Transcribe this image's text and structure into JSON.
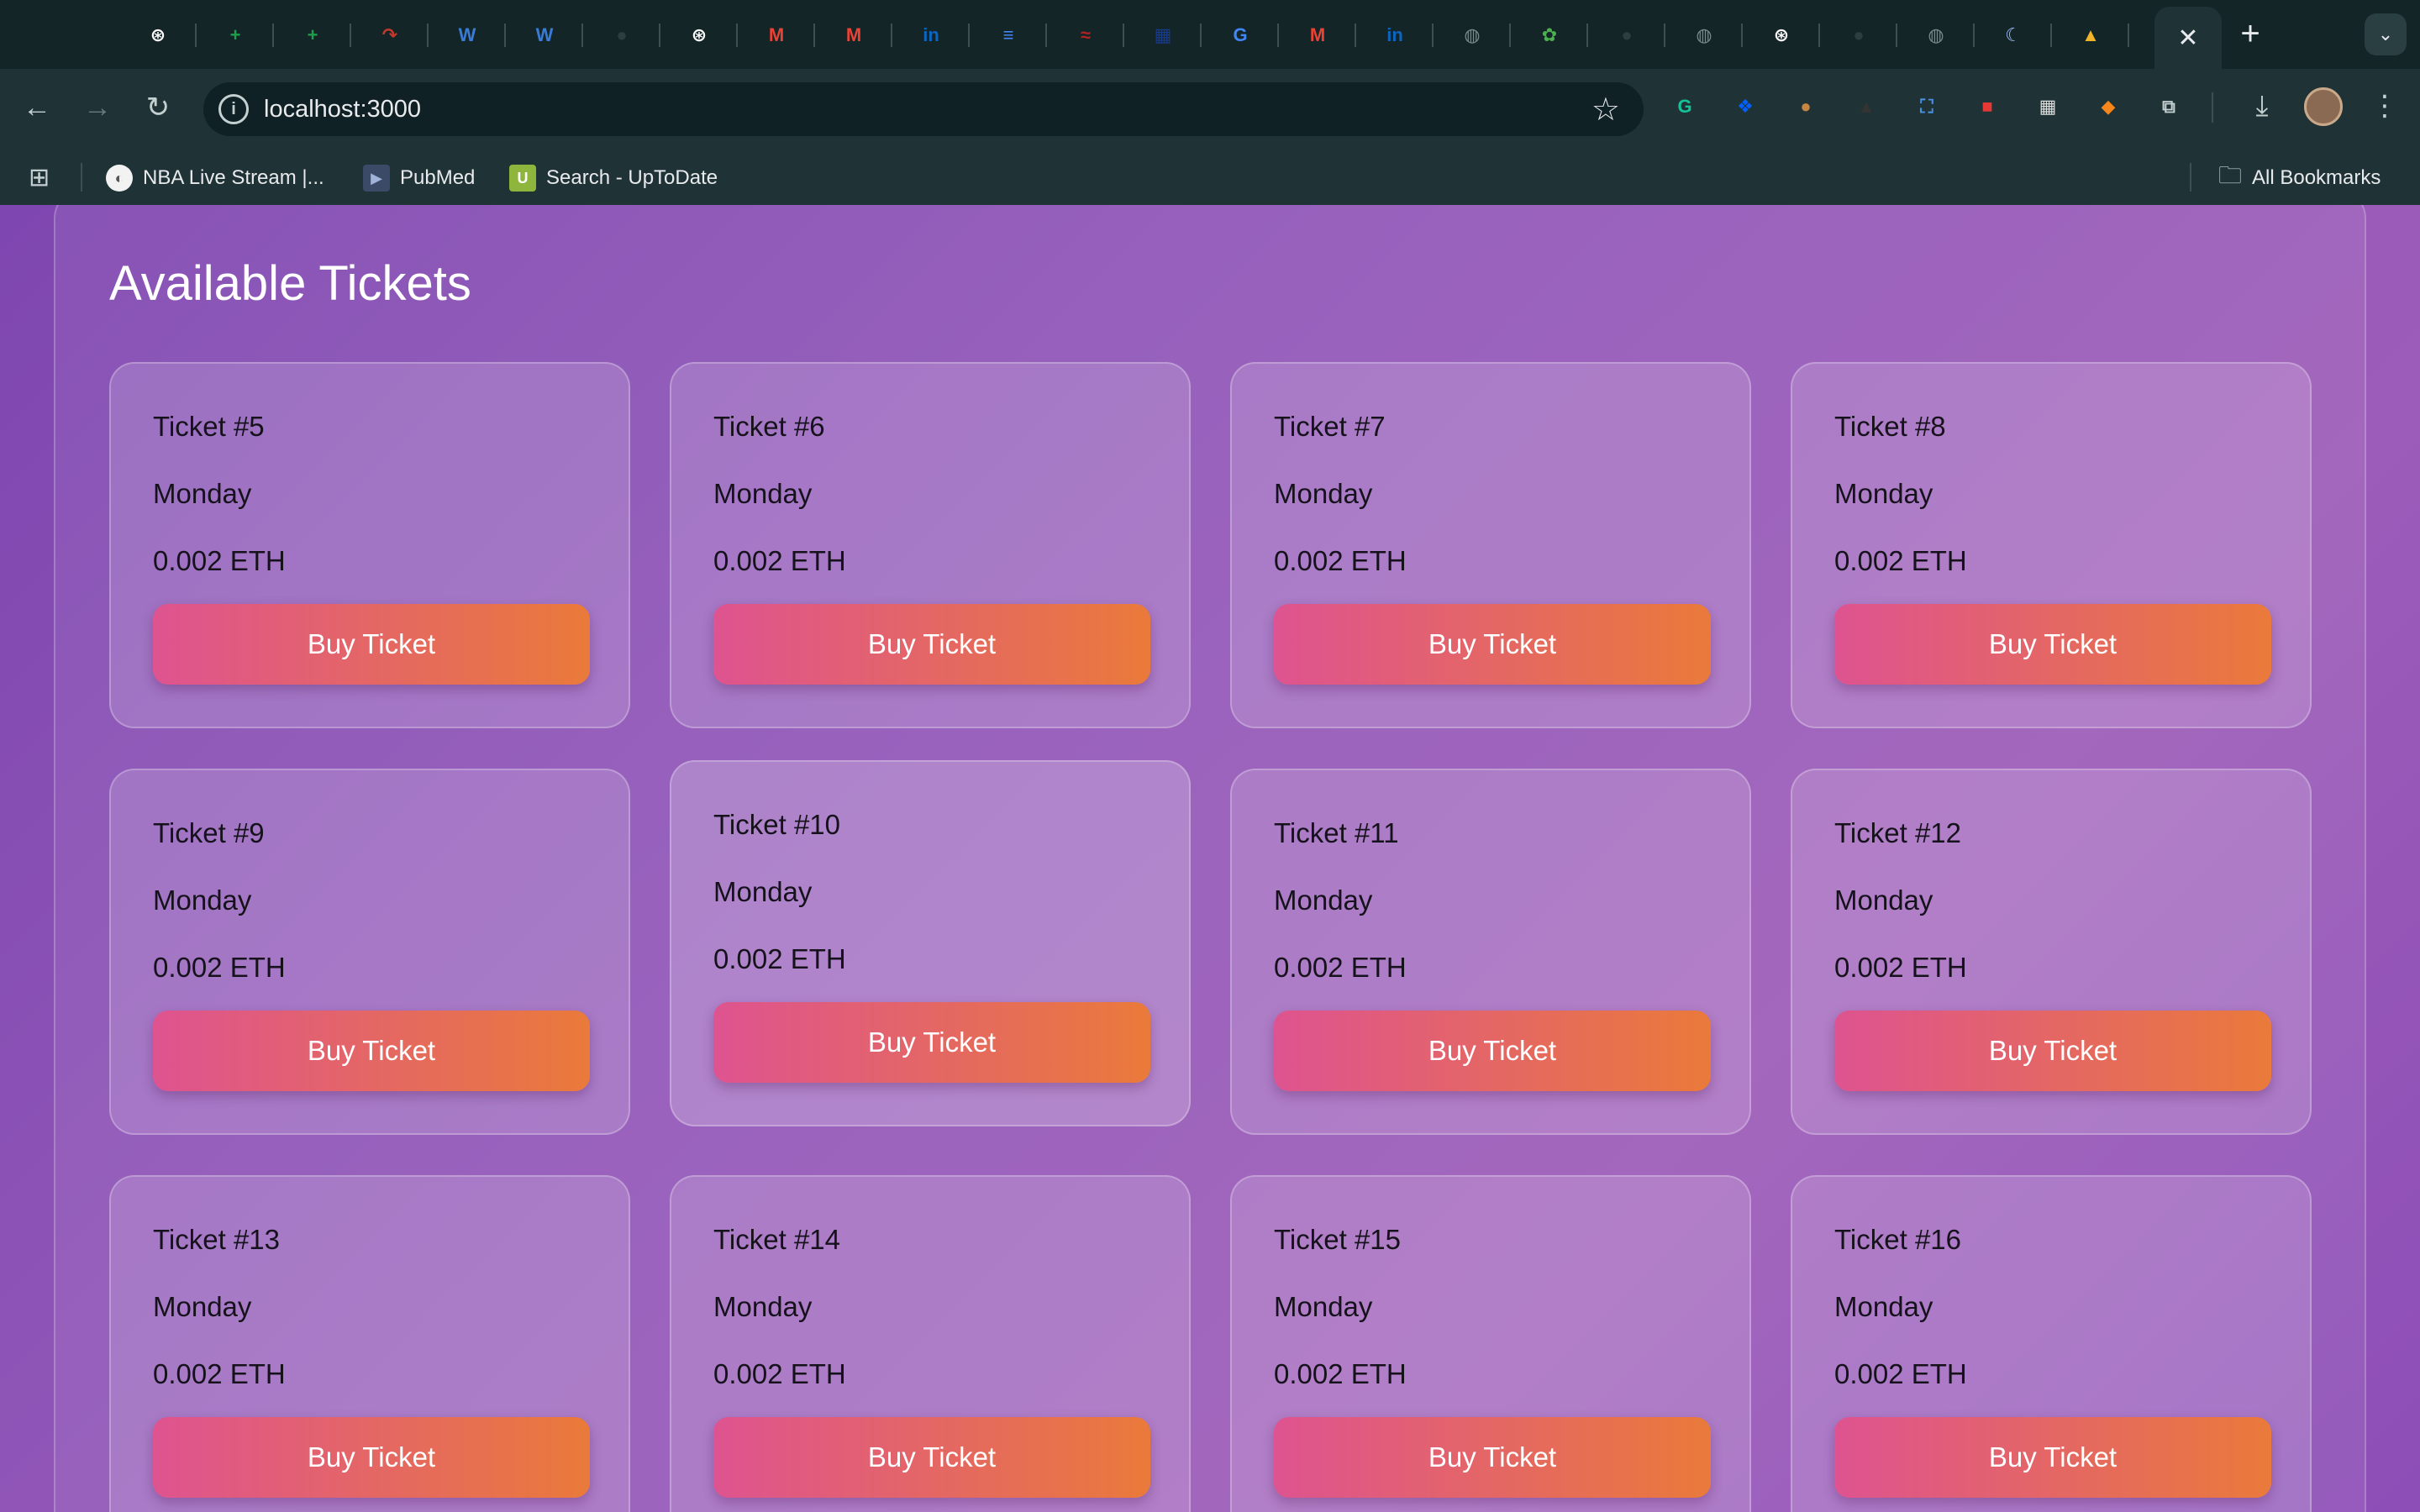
{
  "browser": {
    "tabs": [
      {
        "icon": "openai-icon",
        "glyph": "⊛",
        "color": "#ffffff"
      },
      {
        "icon": "sheets-icon",
        "glyph": "+",
        "color": "#1e9e4a"
      },
      {
        "icon": "sheets-icon",
        "glyph": "+",
        "color": "#1e9e4a"
      },
      {
        "icon": "arrow-icon",
        "glyph": "↷",
        "color": "#c0392b"
      },
      {
        "icon": "w-icon",
        "glyph": "W",
        "color": "#3a7bd5"
      },
      {
        "icon": "w-icon",
        "glyph": "W",
        "color": "#3a7bd5"
      },
      {
        "icon": "github-icon",
        "glyph": "●",
        "color": "#2c3e40"
      },
      {
        "icon": "openai-icon",
        "glyph": "⊛",
        "color": "#ffffff"
      },
      {
        "icon": "gmail-icon",
        "glyph": "M",
        "color": "#ea4335"
      },
      {
        "icon": "gmail-icon",
        "glyph": "M",
        "color": "#ea4335"
      },
      {
        "icon": "linkedin-icon",
        "glyph": "in",
        "color": "#0a66c2"
      },
      {
        "icon": "docs-icon",
        "glyph": "≡",
        "color": "#4285f4"
      },
      {
        "icon": "nejm-icon",
        "glyph": "≈",
        "color": "#b22222"
      },
      {
        "icon": "imdb-icon",
        "glyph": "▦",
        "color": "#1a3a8a"
      },
      {
        "icon": "google-icon",
        "glyph": "G",
        "color": "#4285f4"
      },
      {
        "icon": "gmail-icon",
        "glyph": "M",
        "color": "#ea4335"
      },
      {
        "icon": "linkedin-icon",
        "glyph": "in",
        "color": "#0a66c2"
      },
      {
        "icon": "globe-icon",
        "glyph": "◍",
        "color": "#7a8a8c"
      },
      {
        "icon": "puzzle-icon",
        "glyph": "✿",
        "color": "#4caf50"
      },
      {
        "icon": "github-icon",
        "glyph": "●",
        "color": "#2c3e40"
      },
      {
        "icon": "globe-icon",
        "glyph": "◍",
        "color": "#7a8a8c"
      },
      {
        "icon": "openai-icon",
        "glyph": "⊛",
        "color": "#ffffff"
      },
      {
        "icon": "github-icon",
        "glyph": "●",
        "color": "#2c3e40"
      },
      {
        "icon": "globe-icon",
        "glyph": "◍",
        "color": "#7a8a8c"
      },
      {
        "icon": "moon-icon",
        "glyph": "☾",
        "color": "#9ec3ff"
      },
      {
        "icon": "flame-icon",
        "glyph": "▲",
        "color": "#f0b429"
      }
    ],
    "active_tab_close": "✕",
    "new_tab": "+",
    "tab_search": "⌄",
    "url": "localhost:3000",
    "extensions": [
      {
        "icon": "grammarly-icon",
        "glyph": "G",
        "color": "#15c39a"
      },
      {
        "icon": "dropbox-icon",
        "glyph": "❖",
        "color": "#0061ff"
      },
      {
        "icon": "cookie-icon",
        "glyph": "●",
        "color": "#c68642"
      },
      {
        "icon": "cat-icon",
        "glyph": "▲",
        "color": "#333333"
      },
      {
        "icon": "screenshot-icon",
        "glyph": "⛶",
        "color": "#4a90e2"
      },
      {
        "icon": "record-icon",
        "glyph": "■",
        "color": "#e53935"
      },
      {
        "icon": "qr-icon",
        "glyph": "▦",
        "color": "#dddddd"
      },
      {
        "icon": "metamask-icon",
        "glyph": "◆",
        "color": "#f6851b"
      },
      {
        "icon": "extensions-puzzle-icon",
        "glyph": "⧉",
        "color": "#c4cfd0"
      }
    ],
    "bookmarks": [
      {
        "label": "NBA Live Stream |...",
        "icon": "nba-icon"
      },
      {
        "label": "PubMed",
        "icon": "pubmed-icon"
      },
      {
        "label": "Search - UpToDate",
        "icon": "uptodate-icon"
      }
    ],
    "all_bookmarks": "All Bookmarks"
  },
  "page": {
    "title": "Available Tickets",
    "tickets": [
      {
        "name": "Ticket #5",
        "day": "Monday",
        "price": "0.002 ETH",
        "button": "Buy Ticket"
      },
      {
        "name": "Ticket #6",
        "day": "Monday",
        "price": "0.002 ETH",
        "button": "Buy Ticket"
      },
      {
        "name": "Ticket #7",
        "day": "Monday",
        "price": "0.002 ETH",
        "button": "Buy Ticket"
      },
      {
        "name": "Ticket #8",
        "day": "Monday",
        "price": "0.002 ETH",
        "button": "Buy Ticket"
      },
      {
        "name": "Ticket #9",
        "day": "Monday",
        "price": "0.002 ETH",
        "button": "Buy Ticket"
      },
      {
        "name": "Ticket #10",
        "day": "Monday",
        "price": "0.002 ETH",
        "button": "Buy Ticket"
      },
      {
        "name": "Ticket #11",
        "day": "Monday",
        "price": "0.002 ETH",
        "button": "Buy Ticket"
      },
      {
        "name": "Ticket #12",
        "day": "Monday",
        "price": "0.002 ETH",
        "button": "Buy Ticket"
      },
      {
        "name": "Ticket #13",
        "day": "Monday",
        "price": "0.002 ETH",
        "button": "Buy Ticket"
      },
      {
        "name": "Ticket #14",
        "day": "Monday",
        "price": "0.002 ETH",
        "button": "Buy Ticket"
      },
      {
        "name": "Ticket #15",
        "day": "Monday",
        "price": "0.002 ETH",
        "button": "Buy Ticket"
      },
      {
        "name": "Ticket #16",
        "day": "Monday",
        "price": "0.002 ETH",
        "button": "Buy Ticket"
      }
    ]
  }
}
